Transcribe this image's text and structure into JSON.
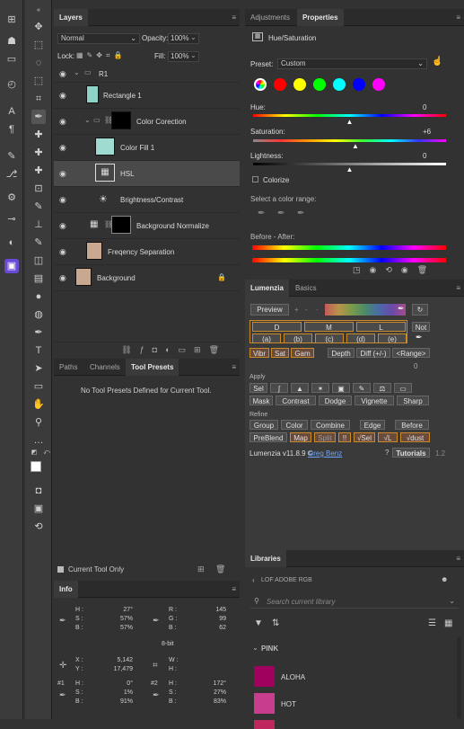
{
  "layers_panel": {
    "tab": "Layers",
    "blend_mode": "Normal",
    "opacity_label": "Opacity:",
    "opacity_value": "100%",
    "lock_label": "Lock:",
    "fill_label": "Fill:",
    "fill_value": "100%",
    "layers": [
      {
        "name": "R1"
      },
      {
        "name": "Rectangle 1"
      },
      {
        "name": "Color Corection"
      },
      {
        "name": "Color Fill 1"
      },
      {
        "name": "HSL"
      },
      {
        "name": "Brightness/Contrast"
      },
      {
        "name": "Background Normalize"
      },
      {
        "name": "Freqency Separation"
      },
      {
        "name": "Background"
      }
    ]
  },
  "paths_panel": {
    "tabs": [
      "Paths",
      "Channels",
      "Tool Presets"
    ],
    "message": "No Tool Presets Defined for Current Tool.",
    "current_tool_only": "Current Tool Only"
  },
  "info_panel": {
    "tab": "Info",
    "block1": {
      "h": "H :",
      "s": "S :",
      "b": "B :",
      "h_val": "27°",
      "s_val": "57%",
      "b_val": "57%"
    },
    "block2": {
      "r": "R :",
      "g": "G :",
      "b": "B :",
      "r_val": "145",
      "g_val": "99",
      "b_val": "62"
    },
    "bit_depth": "8-bit",
    "xy": {
      "x": "X :",
      "y": "Y :",
      "x_val": "5,142",
      "y_val": "17,479"
    },
    "wh": {
      "w": "W :",
      "h": "H :"
    },
    "s1": {
      "label": "#1",
      "h": "H :",
      "s": "S :",
      "b": "B :",
      "h_val": "0°",
      "s_val": "1%",
      "b_val": "91%"
    },
    "s2": {
      "label": "#2",
      "h": "H :",
      "s": "S :",
      "b": "B :",
      "h_val": "172°",
      "s_val": "27%",
      "b_val": "83%"
    }
  },
  "properties_panel": {
    "tabs": [
      "Adjustments",
      "Properties"
    ],
    "title": "Hue/Saturation",
    "preset_label": "Preset:",
    "preset_value": "Custom",
    "hue_label": "Hue:",
    "hue_value": "0",
    "hue_level": 0.5,
    "saturation_label": "Saturation:",
    "saturation_value": "+6",
    "saturation_level": 0.53,
    "lightness_label": "Lightness:",
    "lightness_value": "0",
    "lightness_level": 0.5,
    "colorize_label": "Colorize",
    "range_label": "Select a color range:",
    "before_after_label": "Before - After:",
    "swatch_colors": [
      "#ff0000",
      "#ffff00",
      "#00ff00",
      "#00ffff",
      "#0000ff",
      "#ff00ff"
    ]
  },
  "lumenzia_panel": {
    "tabs": [
      "Lumenzia",
      "Basics"
    ],
    "preview": "Preview",
    "plus": "+",
    "minus": "-",
    "dots": "·",
    "row_dml": [
      "D",
      "M",
      "L"
    ],
    "not": "Not",
    "row_abcde": [
      "(a)",
      "(b)",
      "(c)",
      "(d)",
      "(e)"
    ],
    "row3": [
      "Vibr",
      "Sat",
      "Gam",
      "Depth",
      "Diff (+/-)",
      "<Range>"
    ],
    "zero": "0",
    "apply_label": "Apply",
    "sel": "Sel",
    "apply_row2": [
      "Mask",
      "Contrast",
      "Dodge",
      "Vignette",
      "Sharp"
    ],
    "refine_label": "Refine",
    "refine_row1": [
      "Group",
      "Color",
      "Combine",
      "Edge",
      "Before"
    ],
    "refine_row2": [
      "PreBlend",
      "Map",
      "Split",
      "!!",
      "√Sel",
      "√L",
      "√dust"
    ],
    "version": "Lumenzia v11.8.9 ©",
    "author": "Greg Benz",
    "tutorials": "Tutorials",
    "ui_version": "1.2"
  },
  "libraries_panel": {
    "tab": "Libraries",
    "library_name": "LOF ADOBE RGB",
    "search_placeholder": "Search current library",
    "section": "PINK",
    "swatches": [
      {
        "name": "ALOHA",
        "color": "#a0005e"
      },
      {
        "name": "HOT",
        "color": "#c83d8e"
      }
    ]
  }
}
